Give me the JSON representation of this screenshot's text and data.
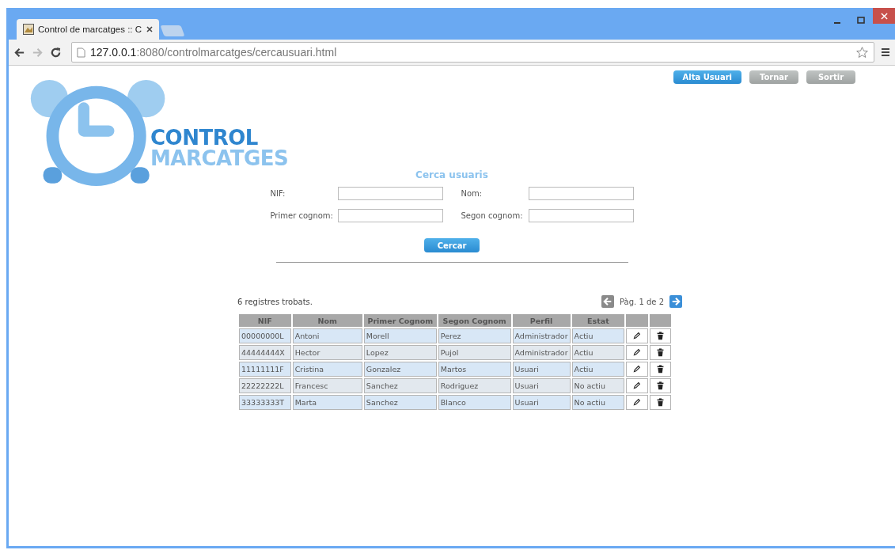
{
  "browser": {
    "tab_title": "Control de marcatges :: C",
    "url_host": "127.0.0.1",
    "url_rest": ":8080/controlmarcatges/cercausuari.html"
  },
  "top_buttons": [
    {
      "label": "Alta Usuari",
      "kind": "primary"
    },
    {
      "label": "Tornar",
      "kind": "secondary"
    },
    {
      "label": "Sortir",
      "kind": "secondary"
    }
  ],
  "logo": {
    "line1": "CONTROL",
    "line2": "MARCATGES"
  },
  "search": {
    "title": "Cerca usuaris",
    "fields": [
      {
        "label": "NIF:"
      },
      {
        "label": "Nom:"
      },
      {
        "label": "Primer cognom:"
      },
      {
        "label": "Segon cognom:"
      }
    ],
    "button": "Cercar"
  },
  "results": {
    "count": "6 registres trobats.",
    "page": "Pàg. 1 de 2"
  },
  "table": {
    "columns": [
      "NIF",
      "Nom",
      "Primer Cognom",
      "Segon Cognom",
      "Perfil",
      "Estat"
    ],
    "rows": [
      {
        "cells": [
          "00000000L",
          "Antoni",
          "Morell",
          "Perez",
          "Administrador",
          "Actiu"
        ]
      },
      {
        "cells": [
          "44444444X",
          "Hector",
          "Lopez",
          "Pujol",
          "Administrador",
          "Actiu"
        ]
      },
      {
        "cells": [
          "11111111F",
          "Cristina",
          "Gonzalez",
          "Martos",
          "Usuari",
          "Actiu"
        ]
      },
      {
        "cells": [
          "22222222L",
          "Francesc",
          "Sanchez",
          "Rodriguez",
          "Usuari",
          "No actiu"
        ]
      },
      {
        "cells": [
          "33333333T",
          "Marta",
          "Sanchez",
          "Blanco",
          "Usuari",
          "No actiu"
        ]
      }
    ]
  }
}
